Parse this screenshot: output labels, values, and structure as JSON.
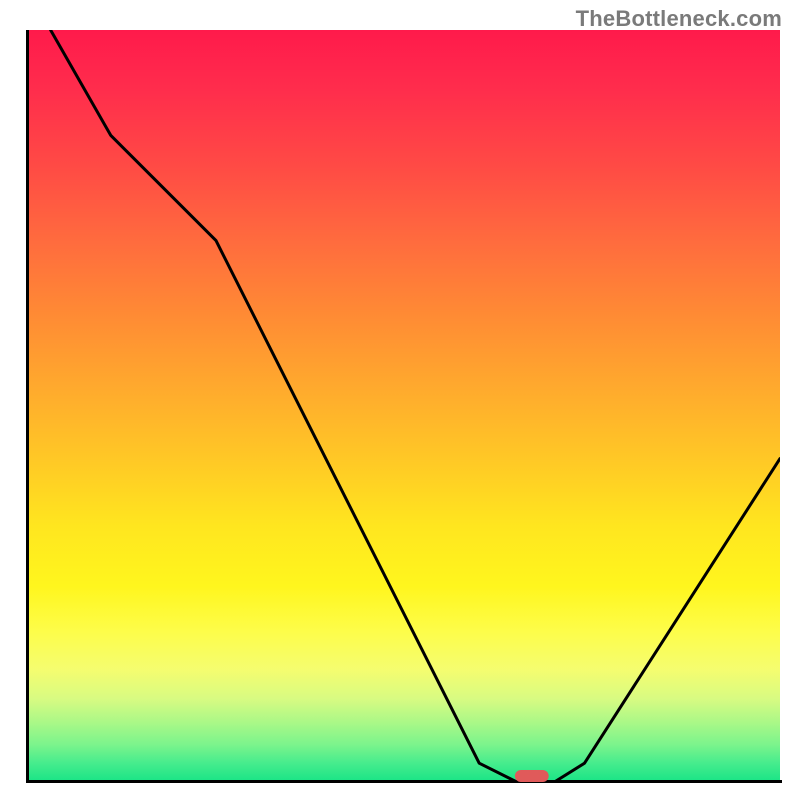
{
  "watermark": "TheBottleneck.com",
  "chart_data": {
    "type": "line",
    "title": "",
    "xlabel": "",
    "ylabel": "",
    "x_range": [
      0,
      100
    ],
    "y_range": [
      0,
      100
    ],
    "legend": null,
    "grid": false,
    "background_gradient_meaning": "bottleneck severity (red = highest, green = none)",
    "series": [
      {
        "name": "bottleneck-curve",
        "x": [
          3,
          11,
          25,
          60,
          65,
          70,
          74,
          100
        ],
        "y": [
          100,
          86,
          72,
          2.5,
          0,
          0,
          2.5,
          43
        ],
        "color": "#000000",
        "comment": "piecewise asymmetric V dipping to baseline near x≈67%"
      }
    ],
    "marker": {
      "name": "optimal-point",
      "shape": "rounded-rect",
      "x": 67,
      "y": 0,
      "color": "#e05a5a",
      "approx_width_pct": 4.5,
      "approx_height_pct": 1.6
    }
  }
}
